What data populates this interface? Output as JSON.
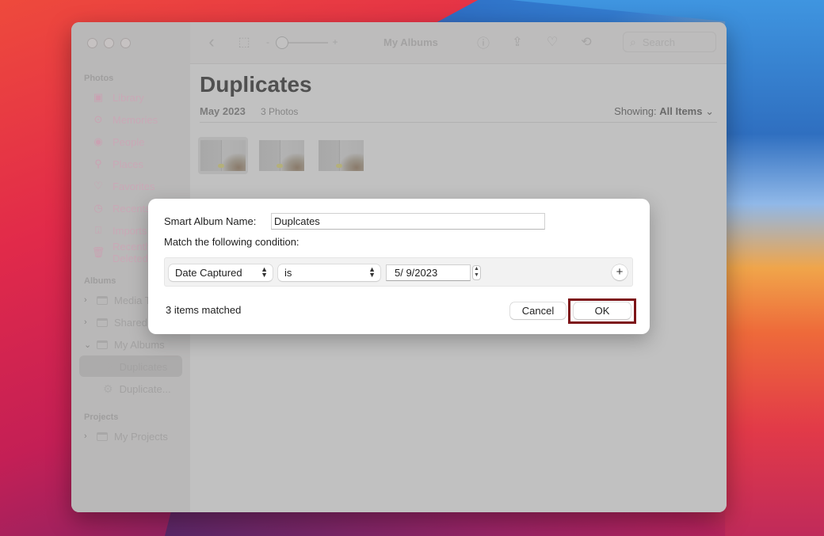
{
  "window": {
    "title": "My Albums"
  },
  "toolbar": {
    "back_icon": "chevron-left-icon",
    "zoom_minus": "-",
    "zoom_plus": "+",
    "zoom_level": 0.0,
    "search_placeholder": "Search"
  },
  "sidebar": {
    "sections": {
      "photos": "Photos",
      "albums": "Albums",
      "projects": "Projects"
    },
    "photos_items": [
      {
        "label": "Library",
        "icon": "library-icon"
      },
      {
        "label": "Memories",
        "icon": "memories-icon"
      },
      {
        "label": "People",
        "icon": "people-icon"
      },
      {
        "label": "Places",
        "icon": "places-icon"
      },
      {
        "label": "Favorites",
        "icon": "heart-icon"
      },
      {
        "label": "Recents",
        "icon": "clock-icon"
      },
      {
        "label": "Imports",
        "icon": "import-icon"
      },
      {
        "label": "Recently Deleted",
        "icon": "trash-icon"
      }
    ],
    "album_items": [
      {
        "label": "Media Types",
        "expanded": false
      },
      {
        "label": "Shared Albums",
        "expanded": false
      },
      {
        "label": "My Albums",
        "expanded": true
      }
    ],
    "my_albums_children": [
      {
        "label": "Duplicates",
        "selected": true
      },
      {
        "label": "Duplicate..."
      }
    ],
    "project_items": [
      {
        "label": "My Projects",
        "expanded": false
      }
    ]
  },
  "main": {
    "title": "Duplicates",
    "date": "May 2023",
    "count": "3 Photos",
    "showing_prefix": "Showing:",
    "showing_value": "All Items",
    "photo_count": 3
  },
  "dialog": {
    "name_label": "Smart Album Name:",
    "name_value": "Duplcates",
    "condition_label": "Match the following condition:",
    "field_select": "Date Captured",
    "operator_select": "is",
    "date_value": "5/  9/2023",
    "add_condition": "+",
    "matched_text": "3 items matched",
    "cancel_label": "Cancel",
    "ok_label": "OK",
    "highlight_color": "#7d1418"
  }
}
